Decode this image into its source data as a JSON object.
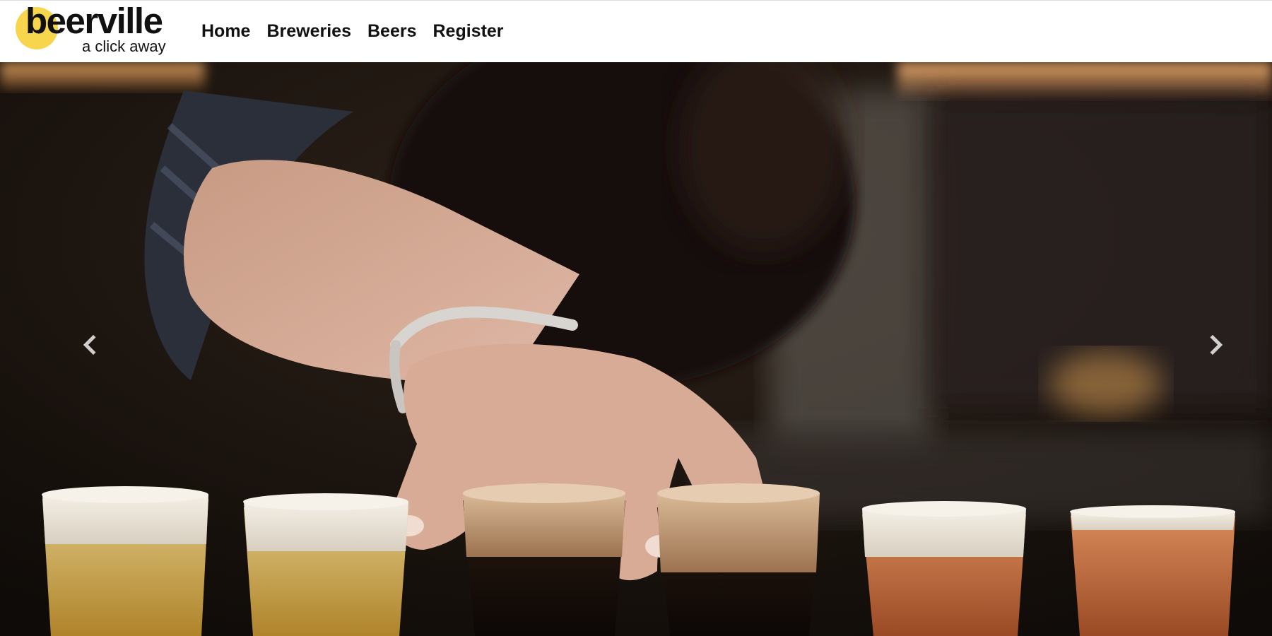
{
  "brand": {
    "name": "beerville",
    "tagline": "a click away",
    "accent_color": "#f7d64e"
  },
  "nav": {
    "items": [
      {
        "label": "Home"
      },
      {
        "label": "Breweries"
      },
      {
        "label": "Beers"
      },
      {
        "label": "Register"
      }
    ]
  },
  "carousel": {
    "prev_icon": "chevron-left-icon",
    "next_icon": "chevron-right-icon",
    "slide_image": "photo-hand-over-beer-flight"
  }
}
